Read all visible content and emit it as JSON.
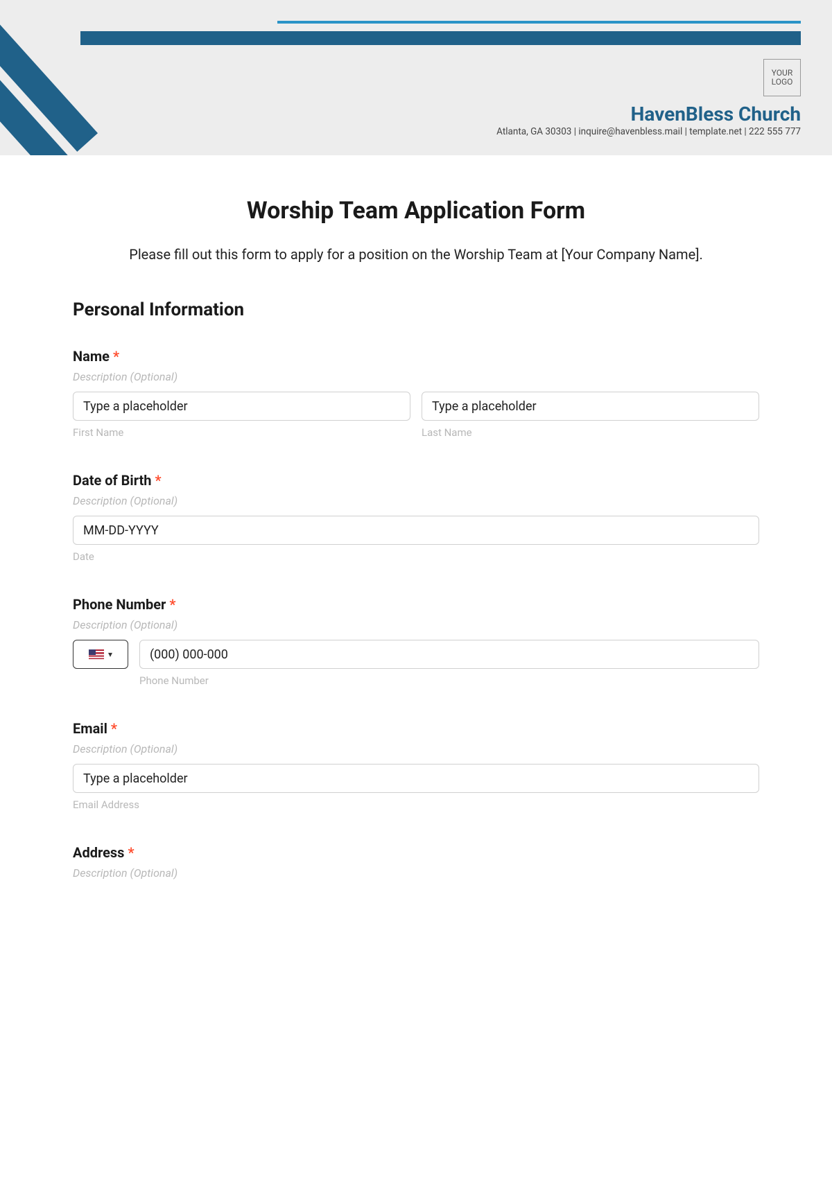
{
  "header": {
    "logo_text": "YOUR LOGO",
    "church_name": "HavenBless Church",
    "contact_line": "Atlanta, GA 30303 | inquire@havenbless.mail | template.net | 222 555 777"
  },
  "form": {
    "title": "Worship Team Application Form",
    "intro": "Please fill out this form to apply for a position on the Worship Team at [Your Company Name].",
    "section_personal": "Personal Information",
    "desc_optional": "Description (Optional)",
    "required_marker": "*",
    "name": {
      "label": "Name",
      "first_placeholder": "Type a placeholder",
      "first_sublabel": "First Name",
      "last_placeholder": "Type a placeholder",
      "last_sublabel": "Last Name"
    },
    "dob": {
      "label": "Date of Birth",
      "placeholder": "MM-DD-YYYY",
      "sublabel": "Date"
    },
    "phone": {
      "label": "Phone Number",
      "placeholder": "(000) 000-000",
      "sublabel": "Phone Number"
    },
    "email": {
      "label": "Email",
      "placeholder": "Type a placeholder",
      "sublabel": "Email Address"
    },
    "address": {
      "label": "Address"
    }
  }
}
